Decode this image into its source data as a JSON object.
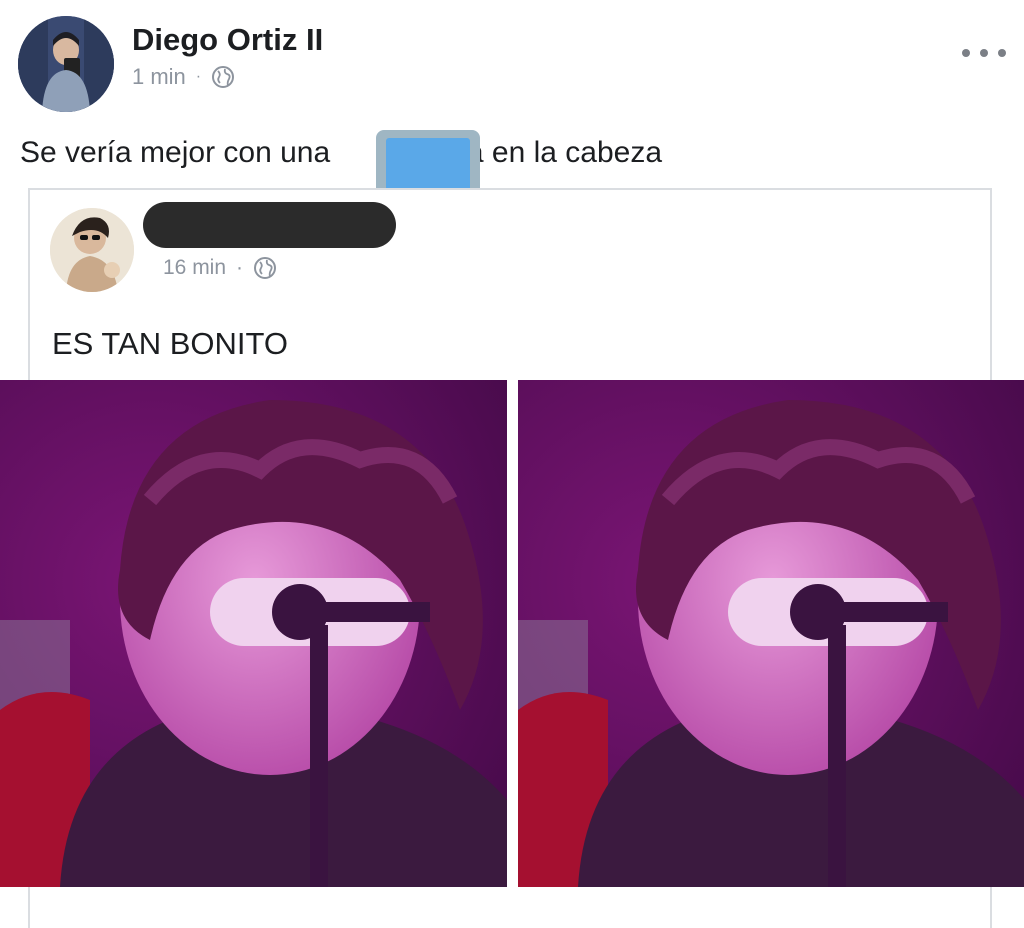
{
  "post": {
    "author": "Diego Ortiz II",
    "time": "1 min",
    "separator": "·",
    "privacy_icon": "globe-icon",
    "more_icon": "more-options-icon",
    "text_before": "Se vería mejor con una",
    "text_after": "a en la cabeza",
    "emoji_icon": "desktop-computer-icon"
  },
  "shared": {
    "author_redacted": true,
    "time": "16 min",
    "separator": "·",
    "privacy_icon": "globe-icon",
    "text": "ES TAN BONITO",
    "photos": [
      "singer-photo",
      "singer-photo"
    ]
  },
  "colors": {
    "text": "#1c1e21",
    "meta": "#8d949e",
    "border": "#dadde1",
    "redaction": "#2b2b2b",
    "photo_tint": "#9a1f8c"
  }
}
